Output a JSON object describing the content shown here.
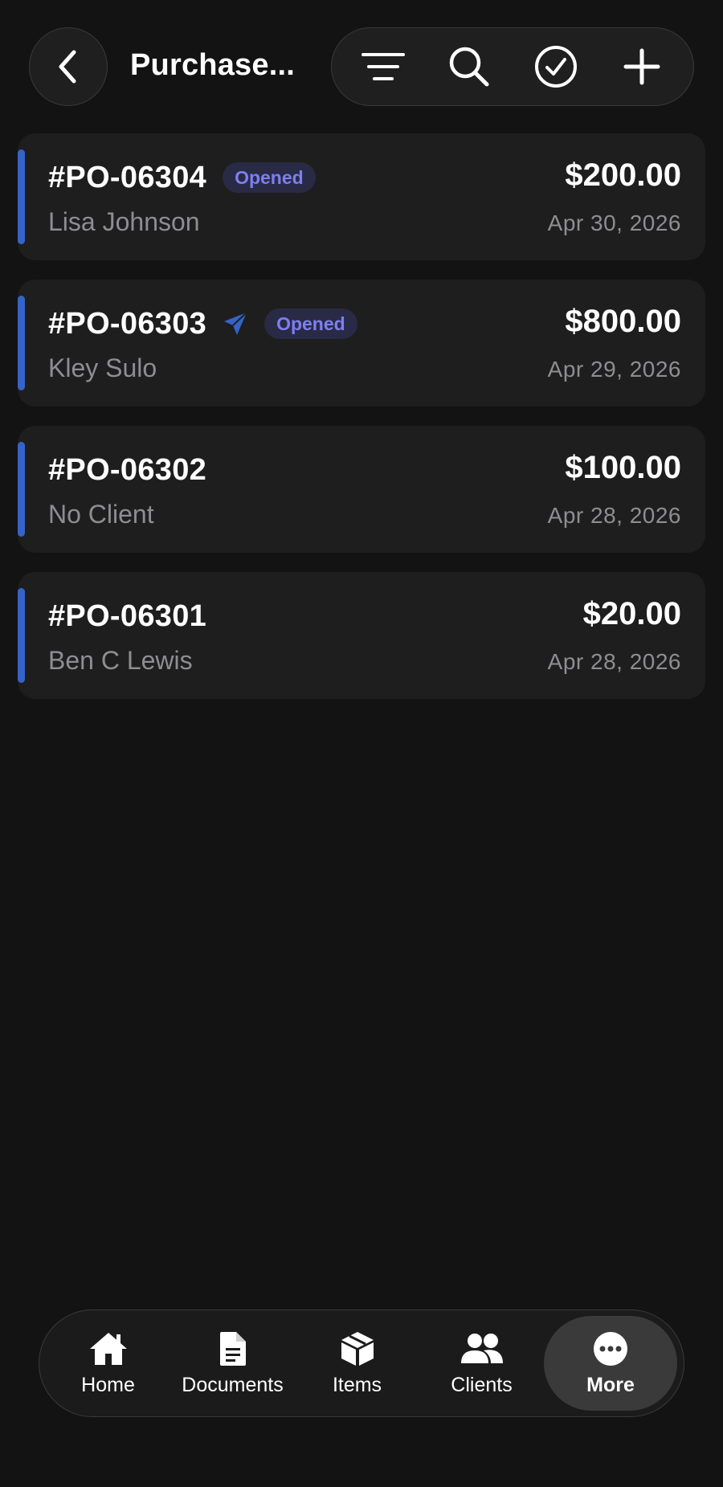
{
  "header": {
    "title": "Purchase...",
    "back_icon": "chevron-left-icon",
    "tools": [
      "filter-icon",
      "search-icon",
      "select-check-icon",
      "add-icon"
    ]
  },
  "colors": {
    "background": "#131313",
    "card": "#1e1e1e",
    "accent": "#3563c9",
    "badge_text": "#7d7ff0",
    "secondary_text": "#8e8e92"
  },
  "orders": [
    {
      "number": "#PO-06304",
      "status": "Opened",
      "sent": false,
      "client": "Lisa Johnson",
      "amount": "$200.00",
      "date": "Apr 30, 2026"
    },
    {
      "number": "#PO-06303",
      "status": "Opened",
      "sent": true,
      "client": "Kley Sulo",
      "amount": "$800.00",
      "date": "Apr 29, 2026"
    },
    {
      "number": "#PO-06302",
      "status": "",
      "sent": false,
      "client": "No Client",
      "amount": "$100.00",
      "date": "Apr 28, 2026"
    },
    {
      "number": "#PO-06301",
      "status": "",
      "sent": false,
      "client": "Ben C Lewis",
      "amount": "$20.00",
      "date": "Apr 28, 2026"
    }
  ],
  "tabbar": {
    "tabs": [
      {
        "label": "Home",
        "icon": "home-icon"
      },
      {
        "label": "Documents",
        "icon": "document-icon"
      },
      {
        "label": "Items",
        "icon": "box-icon"
      },
      {
        "label": "Clients",
        "icon": "users-icon"
      },
      {
        "label": "More",
        "icon": "more-icon",
        "active": true
      }
    ]
  }
}
